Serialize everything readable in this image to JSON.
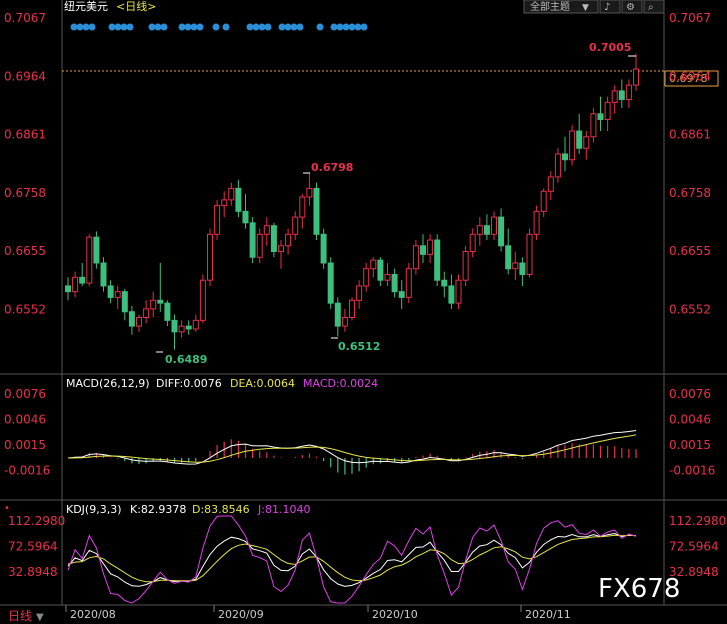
{
  "header": {
    "symbol": "纽元美元",
    "period": "<日线>",
    "theme_button": "全部主题",
    "theme_arrow": "▼",
    "max_price_left": "0.7067",
    "max_price_right": "0.7067"
  },
  "price_axis": [
    "0.7067",
    "0.6964",
    "0.6861",
    "0.6758",
    "0.6655",
    "0.6552"
  ],
  "current_price": "0.6978",
  "annotations": {
    "high": "0.7005",
    "mid_high": "0.6798",
    "low1": "0.6489",
    "low2": "0.6512"
  },
  "macd": {
    "title": "MACD(26,12,9)",
    "diff": "DIFF:0.0076",
    "dea": "DEA:0.0064",
    "macd": "MACD:0.0024",
    "axis": [
      "0.0076",
      "0.0046",
      "0.0015",
      "-0.0016"
    ]
  },
  "kdj": {
    "title": "KDJ(9,3,3)",
    "k": "K:82.9378",
    "d": "D:83.8546",
    "j": "J:81.1040",
    "axis": [
      "112.2980",
      "72.5964",
      "32.8948"
    ]
  },
  "bottom": {
    "period_label": "日线",
    "months": [
      "2020/08",
      "2020/09",
      "2020/10",
      "2020/11"
    ]
  },
  "watermark": "FX678",
  "colors": {
    "up": "#e8304a",
    "down": "#3dbf7e",
    "diff": "#ffffff",
    "dea": "#e7e34a",
    "kdj_j": "#e040e8",
    "axis_text": "#e8304a",
    "dots": "#2a8fd6"
  },
  "chart_data": {
    "type": "candlestick",
    "title": "纽元美元 <日线>",
    "ylim": [
      0.645,
      0.7067
    ],
    "candles": [
      [
        0.66,
        0.6615,
        0.6575,
        0.659
      ],
      [
        0.659,
        0.6625,
        0.658,
        0.6615
      ],
      [
        0.6615,
        0.664,
        0.66,
        0.6605
      ],
      [
        0.6605,
        0.669,
        0.66,
        0.6685
      ],
      [
        0.6685,
        0.6695,
        0.663,
        0.664
      ],
      [
        0.664,
        0.665,
        0.659,
        0.66
      ],
      [
        0.66,
        0.661,
        0.657,
        0.658
      ],
      [
        0.658,
        0.66,
        0.656,
        0.659
      ],
      [
        0.659,
        0.6595,
        0.654,
        0.6555
      ],
      [
        0.6555,
        0.6565,
        0.6515,
        0.653
      ],
      [
        0.653,
        0.655,
        0.652,
        0.6545
      ],
      [
        0.6545,
        0.6575,
        0.6535,
        0.656
      ],
      [
        0.656,
        0.659,
        0.6545,
        0.6575
      ],
      [
        0.6575,
        0.664,
        0.6555,
        0.657
      ],
      [
        0.657,
        0.6575,
        0.653,
        0.654
      ],
      [
        0.654,
        0.655,
        0.6489,
        0.652
      ],
      [
        0.652,
        0.654,
        0.651,
        0.653
      ],
      [
        0.653,
        0.654,
        0.6515,
        0.6525
      ],
      [
        0.6525,
        0.655,
        0.652,
        0.654
      ],
      [
        0.654,
        0.662,
        0.6535,
        0.661
      ],
      [
        0.661,
        0.67,
        0.66,
        0.669
      ],
      [
        0.669,
        0.675,
        0.668,
        0.674
      ],
      [
        0.674,
        0.6765,
        0.672,
        0.675
      ],
      [
        0.675,
        0.678,
        0.674,
        0.677
      ],
      [
        0.677,
        0.6785,
        0.672,
        0.673
      ],
      [
        0.673,
        0.676,
        0.67,
        0.671
      ],
      [
        0.671,
        0.672,
        0.664,
        0.665
      ],
      [
        0.665,
        0.67,
        0.664,
        0.669
      ],
      [
        0.669,
        0.672,
        0.667,
        0.6705
      ],
      [
        0.6705,
        0.671,
        0.665,
        0.666
      ],
      [
        0.666,
        0.668,
        0.663,
        0.667
      ],
      [
        0.667,
        0.67,
        0.6655,
        0.669
      ],
      [
        0.669,
        0.673,
        0.668,
        0.672
      ],
      [
        0.672,
        0.676,
        0.67,
        0.6755
      ],
      [
        0.6755,
        0.6798,
        0.674,
        0.677
      ],
      [
        0.677,
        0.678,
        0.668,
        0.669
      ],
      [
        0.669,
        0.67,
        0.663,
        0.664
      ],
      [
        0.664,
        0.665,
        0.656,
        0.657
      ],
      [
        0.657,
        0.658,
        0.6512,
        0.653
      ],
      [
        0.653,
        0.656,
        0.652,
        0.6545
      ],
      [
        0.6545,
        0.658,
        0.654,
        0.6575
      ],
      [
        0.6575,
        0.661,
        0.656,
        0.66
      ],
      [
        0.66,
        0.664,
        0.659,
        0.663
      ],
      [
        0.663,
        0.665,
        0.6615,
        0.6645
      ],
      [
        0.6645,
        0.665,
        0.66,
        0.661
      ],
      [
        0.661,
        0.664,
        0.66,
        0.662
      ],
      [
        0.662,
        0.663,
        0.658,
        0.659
      ],
      [
        0.659,
        0.661,
        0.656,
        0.658
      ],
      [
        0.658,
        0.664,
        0.657,
        0.663
      ],
      [
        0.663,
        0.668,
        0.662,
        0.667
      ],
      [
        0.667,
        0.669,
        0.664,
        0.6655
      ],
      [
        0.6655,
        0.669,
        0.664,
        0.668
      ],
      [
        0.668,
        0.669,
        0.66,
        0.661
      ],
      [
        0.661,
        0.6625,
        0.658,
        0.66
      ],
      [
        0.66,
        0.662,
        0.656,
        0.657
      ],
      [
        0.657,
        0.662,
        0.656,
        0.661
      ],
      [
        0.661,
        0.667,
        0.66,
        0.666
      ],
      [
        0.666,
        0.67,
        0.665,
        0.669
      ],
      [
        0.669,
        0.672,
        0.667,
        0.6705
      ],
      [
        0.6705,
        0.6725,
        0.668,
        0.669
      ],
      [
        0.669,
        0.673,
        0.668,
        0.672
      ],
      [
        0.672,
        0.6735,
        0.666,
        0.667
      ],
      [
        0.667,
        0.67,
        0.662,
        0.663
      ],
      [
        0.663,
        0.666,
        0.661,
        0.664
      ],
      [
        0.664,
        0.665,
        0.66,
        0.662
      ],
      [
        0.662,
        0.67,
        0.6615,
        0.669
      ],
      [
        0.669,
        0.674,
        0.668,
        0.673
      ],
      [
        0.673,
        0.677,
        0.672,
        0.6765
      ],
      [
        0.6765,
        0.68,
        0.675,
        0.679
      ],
      [
        0.679,
        0.684,
        0.678,
        0.683
      ],
      [
        0.683,
        0.686,
        0.68,
        0.682
      ],
      [
        0.682,
        0.688,
        0.681,
        0.687
      ],
      [
        0.687,
        0.69,
        0.683,
        0.684
      ],
      [
        0.684,
        0.687,
        0.682,
        0.686
      ],
      [
        0.686,
        0.691,
        0.685,
        0.69
      ],
      [
        0.69,
        0.693,
        0.687,
        0.689
      ],
      [
        0.689,
        0.693,
        0.687,
        0.692
      ],
      [
        0.692,
        0.695,
        0.69,
        0.694
      ],
      [
        0.694,
        0.696,
        0.691,
        0.6925
      ],
      [
        0.6925,
        0.696,
        0.691,
        0.695
      ],
      [
        0.695,
        0.7005,
        0.694,
        0.6978
      ]
    ]
  }
}
